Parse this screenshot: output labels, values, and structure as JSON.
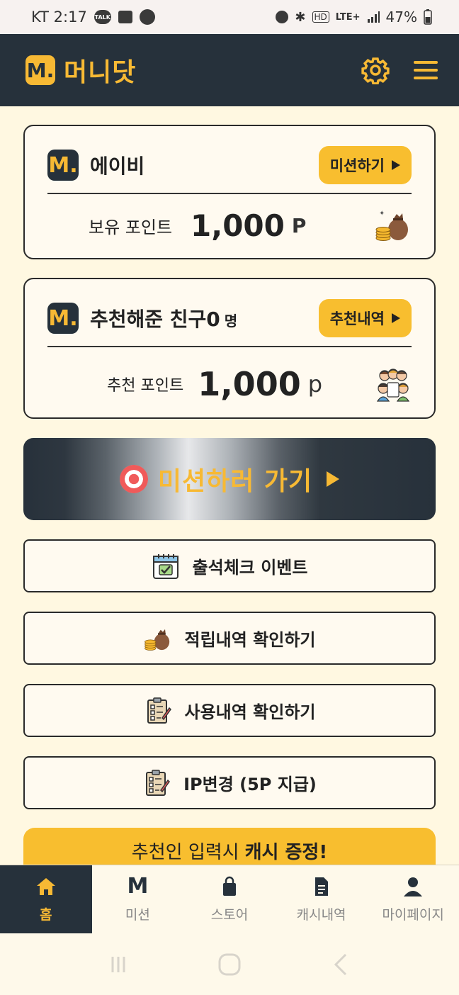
{
  "status_bar": {
    "carrier_time": "KT 2:17",
    "talk_badge": "TALK",
    "battery": "47%",
    "network": "LTE+"
  },
  "app": {
    "logo_mark": "M.",
    "name": "머니닷"
  },
  "user_card": {
    "badge": "M.",
    "name": "에이비",
    "action_label": "미션하기",
    "points_label": "보유 포인트",
    "points_value": "1,000",
    "points_unit": "P"
  },
  "referral_card": {
    "badge": "M.",
    "title": "추천해준 친구0",
    "title_unit": "명",
    "action_label": "추천내역",
    "points_label": "추천 포인트",
    "points_value": "1,000",
    "points_unit": "p"
  },
  "mission_banner": {
    "label": "미션하러 가기"
  },
  "menu": [
    {
      "label": "출석체크 이벤트",
      "icon": "calendar-check-icon"
    },
    {
      "label": "적립내역 확인하기",
      "icon": "money-bag-icon"
    },
    {
      "label": "사용내역 확인하기",
      "icon": "checklist-icon"
    },
    {
      "label": "IP변경 (5P 지급)",
      "icon": "checklist-icon"
    }
  ],
  "promo": {
    "text": "추천인 입력시",
    "emphasis": "캐시 증정!"
  },
  "tabs": [
    {
      "label": "홈",
      "icon": "home-icon",
      "active": true
    },
    {
      "label": "미션",
      "icon": "m-icon"
    },
    {
      "label": "스토어",
      "icon": "shopping-bag-icon"
    },
    {
      "label": "캐시내역",
      "icon": "document-icon"
    },
    {
      "label": "마이페이지",
      "icon": "person-icon"
    }
  ],
  "colors": {
    "dark": "#26313b",
    "accent": "#f7b934",
    "background": "#fff8e1"
  }
}
